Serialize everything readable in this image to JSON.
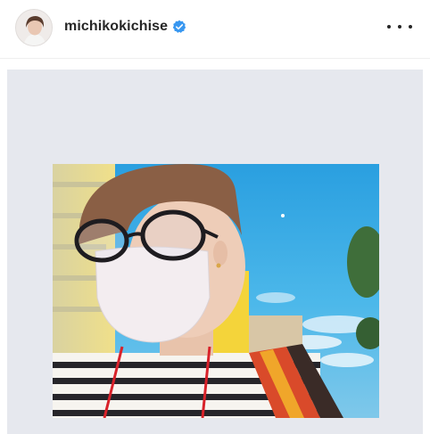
{
  "header": {
    "username": "michikokichise",
    "verified_icon": "verified-badge-icon",
    "more_icon": "more-options-icon"
  },
  "colors": {
    "verified": "#3897f0",
    "username_text": "#262626",
    "post_background": "#e6e8ee",
    "sky": "#43b6e8",
    "lanyard": "#d8222a"
  },
  "post": {
    "image": "selfie-photo"
  }
}
